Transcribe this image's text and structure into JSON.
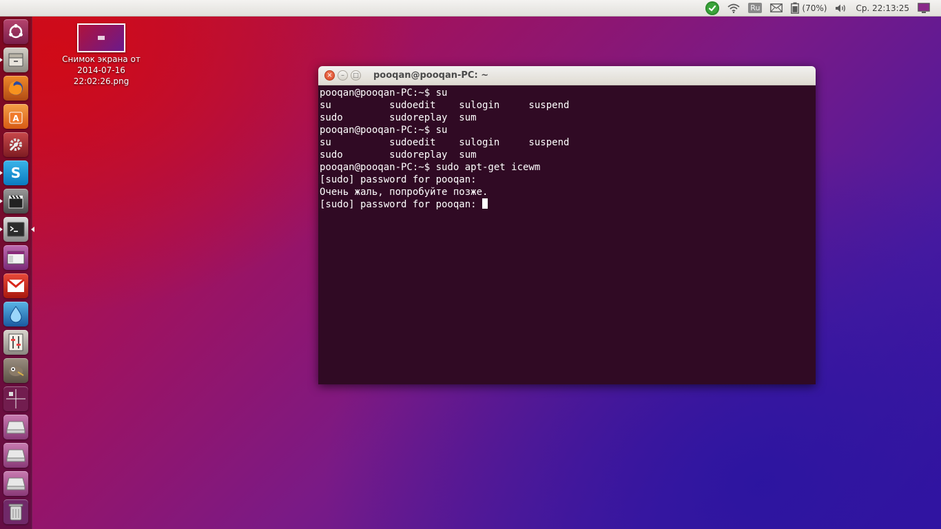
{
  "top_panel": {
    "language": "Ru",
    "battery_percent": "(70%)",
    "clock": "Ср. 22:13:25"
  },
  "launcher": {
    "items": [
      {
        "name": "dash-home"
      },
      {
        "name": "files"
      },
      {
        "name": "firefox"
      },
      {
        "name": "software-center"
      },
      {
        "name": "system-settings"
      },
      {
        "name": "skype"
      },
      {
        "name": "video-editor"
      },
      {
        "name": "terminal"
      },
      {
        "name": "window-app"
      },
      {
        "name": "gmail"
      },
      {
        "name": "drop-app"
      },
      {
        "name": "mixer"
      },
      {
        "name": "gimp"
      },
      {
        "name": "workspace-switcher"
      },
      {
        "name": "drive-1"
      },
      {
        "name": "drive-2"
      },
      {
        "name": "drive-3"
      },
      {
        "name": "trash"
      }
    ]
  },
  "desktop": {
    "file_label": "Снимок экрана от\n2014-07-16\n22:02:26.png"
  },
  "terminal": {
    "title": "pooqan@pooqan-PC: ~",
    "lines": [
      "pooqan@pooqan-PC:~$ su",
      "su          sudoedit    sulogin     suspend",
      "sudo        sudoreplay  sum",
      "pooqan@pooqan-PC:~$ su",
      "su          sudoedit    sulogin     suspend",
      "sudo        sudoreplay  sum",
      "pooqan@pooqan-PC:~$ sudo apt-get icewm",
      "[sudo] password for pooqan:",
      "Очень жаль, попробуйте позже.",
      "[sudo] password for pooqan: "
    ]
  }
}
